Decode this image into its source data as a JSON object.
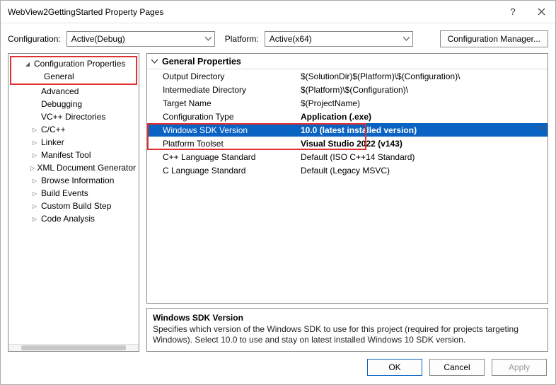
{
  "window": {
    "title": "WebView2GettingStarted Property Pages"
  },
  "toolbar": {
    "configuration_label": "Configuration:",
    "configuration_value": "Active(Debug)",
    "platform_label": "Platform:",
    "platform_value": "Active(x64)",
    "cfg_mgr_label": "Configuration Manager..."
  },
  "tree": {
    "root_label": "Configuration Properties",
    "items": [
      {
        "label": "General",
        "selected": true
      },
      {
        "label": "Advanced"
      },
      {
        "label": "Debugging"
      },
      {
        "label": "VC++ Directories"
      },
      {
        "label": "C/C++",
        "expandable": true
      },
      {
        "label": "Linker",
        "expandable": true
      },
      {
        "label": "Manifest Tool",
        "expandable": true
      },
      {
        "label": "XML Document Generator",
        "expandable": true
      },
      {
        "label": "Browse Information",
        "expandable": true
      },
      {
        "label": "Build Events",
        "expandable": true
      },
      {
        "label": "Custom Build Step",
        "expandable": true
      },
      {
        "label": "Code Analysis",
        "expandable": true
      }
    ]
  },
  "grid": {
    "group_label": "General Properties",
    "rows": [
      {
        "name": "Output Directory",
        "value": "$(SolutionDir)$(Platform)\\$(Configuration)\\"
      },
      {
        "name": "Intermediate Directory",
        "value": "$(Platform)\\$(Configuration)\\"
      },
      {
        "name": "Target Name",
        "value": "$(ProjectName)"
      },
      {
        "name": "Configuration Type",
        "value": "Application (.exe)",
        "bold": true
      },
      {
        "name": "Windows SDK Version",
        "value": "10.0 (latest installed version)",
        "bold": true,
        "selected": true,
        "dropdown": true
      },
      {
        "name": "Platform Toolset",
        "value": "Visual Studio 2022 (v143)",
        "bold": true
      },
      {
        "name": "C++ Language Standard",
        "value": "Default (ISO C++14 Standard)"
      },
      {
        "name": "C Language Standard",
        "value": "Default (Legacy MSVC)"
      }
    ]
  },
  "description": {
    "title": "Windows SDK Version",
    "text": "Specifies which version of the Windows SDK to use for this project (required for projects targeting Windows). Select 10.0 to use and stay on latest installed Windows 10 SDK version."
  },
  "footer": {
    "ok": "OK",
    "cancel": "Cancel",
    "apply": "Apply"
  }
}
